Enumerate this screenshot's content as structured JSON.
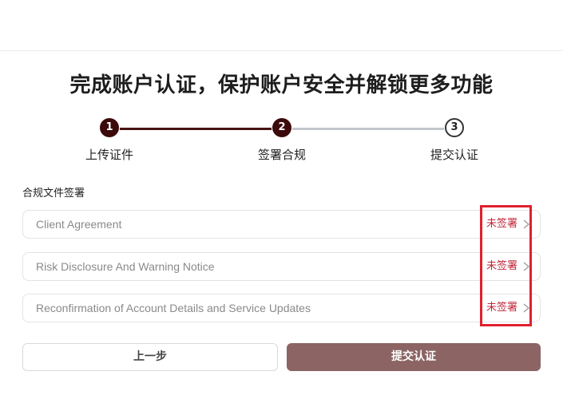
{
  "page": {
    "title": "完成账户认证，保护账户安全并解锁更多功能"
  },
  "stepper": {
    "steps": [
      {
        "number": "1",
        "label": "上传证件",
        "state": "done"
      },
      {
        "number": "2",
        "label": "签署合规",
        "state": "current"
      },
      {
        "number": "3",
        "label": "提交认证",
        "state": "todo"
      }
    ]
  },
  "documents": {
    "section_title": "合规文件签署",
    "items": [
      {
        "name": "Client Agreement",
        "status": "未签署"
      },
      {
        "name": "Risk Disclosure And Warning Notice",
        "status": "未签署"
      },
      {
        "name": "Reconfirmation of Account Details and Service Updates",
        "status": "未签署"
      }
    ]
  },
  "actions": {
    "prev_label": "上一步",
    "submit_label": "提交认证"
  },
  "colors": {
    "accent": "#3c0a0a",
    "status_unsigned": "#c0283b",
    "submit_button": "#8c6464",
    "highlight": "#e0202e"
  },
  "icons": {
    "row_arrow": "chevron-right-icon"
  }
}
